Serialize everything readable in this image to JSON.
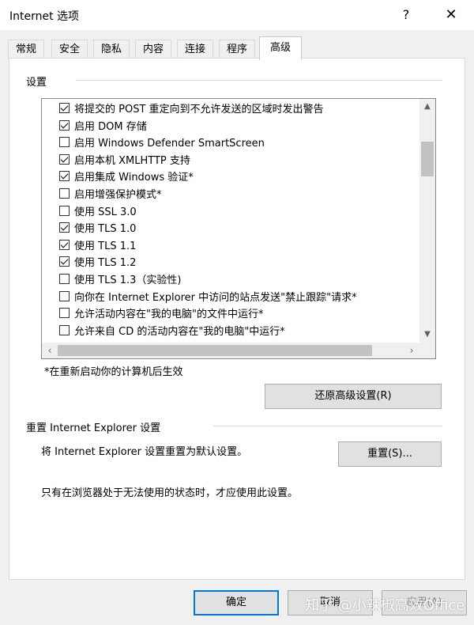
{
  "window": {
    "title": "Internet 选项",
    "help_glyph": "?",
    "close_glyph": "✕"
  },
  "tabs": [
    {
      "label": "常规"
    },
    {
      "label": "安全"
    },
    {
      "label": "隐私"
    },
    {
      "label": "内容"
    },
    {
      "label": "连接"
    },
    {
      "label": "程序"
    },
    {
      "label": "高级",
      "active": true
    }
  ],
  "settings": {
    "group_label": "设置",
    "items": [
      {
        "label": "将提交的 POST 重定向到不允许发送的区域时发出警告",
        "checked": true
      },
      {
        "label": "启用 DOM 存储",
        "checked": true
      },
      {
        "label": "启用 Windows Defender SmartScreen",
        "checked": false
      },
      {
        "label": "启用本机 XMLHTTP 支持",
        "checked": true
      },
      {
        "label": "启用集成 Windows 验证*",
        "checked": true
      },
      {
        "label": "启用增强保护模式*",
        "checked": false
      },
      {
        "label": "使用 SSL 3.0",
        "checked": false
      },
      {
        "label": "使用 TLS 1.0",
        "checked": true
      },
      {
        "label": "使用 TLS 1.1",
        "checked": true
      },
      {
        "label": "使用 TLS 1.2",
        "checked": true
      },
      {
        "label": "使用 TLS 1.3（实验性)",
        "checked": false
      },
      {
        "label": "向你在 Internet Explorer 中访问的站点发送\"禁止跟踪\"请求*",
        "checked": false
      },
      {
        "label": "允许活动内容在\"我的电脑\"的文件中运行*",
        "checked": false
      },
      {
        "label": "允许来自 CD 的活动内容在\"我的电脑\"中运行*",
        "checked": false
      }
    ],
    "restart_note": "*在重新启动你的计算机后生效",
    "restore_button": "还原高级设置(R)"
  },
  "reset": {
    "group_label": "重置 Internet Explorer 设置",
    "description": "将 Internet Explorer 设置重置为默认设置。",
    "button": "重置(S)...",
    "hint": "只有在浏览器处于无法使用的状态时，才应使用此设置。"
  },
  "footer": {
    "ok": "确定",
    "cancel": "取消",
    "apply": "应用(A)"
  },
  "watermark": "知乎 @小辣椒高效Office",
  "colors": {
    "accent": "#0078d7",
    "dialog_bg": "#f0f0f0",
    "panel_bg": "#ffffff"
  }
}
